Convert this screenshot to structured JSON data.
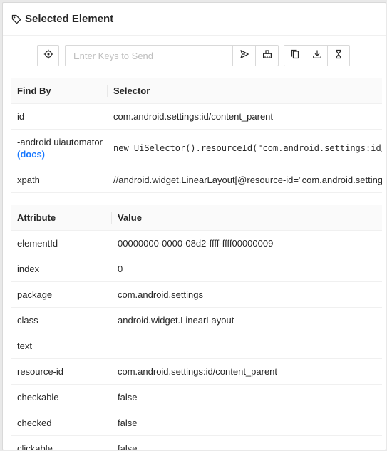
{
  "header": {
    "title": "Selected Element",
    "icon": "tag-icon"
  },
  "toolbar": {
    "input_placeholder": "Enter Keys to Send",
    "input_value": "",
    "buttons": [
      "locate-icon",
      "send-icon",
      "clear-icon",
      "copy-icon",
      "download-icon",
      "hourglass-icon"
    ]
  },
  "find_by": {
    "headers": {
      "col1": "Find By",
      "col2": "Selector"
    },
    "rows": [
      {
        "by": "id",
        "selector": "com.android.settings:id/content_parent"
      },
      {
        "by": "-android uiautomator",
        "docs": "(docs)",
        "selector": "new UiSelector().resourceId(\"com.android.settings:id/content_parent\")"
      },
      {
        "by": "xpath",
        "selector": "//android.widget.LinearLayout[@resource-id=\"com.android.settings:id/content_parent\"]"
      }
    ]
  },
  "attributes": {
    "headers": {
      "col1": "Attribute",
      "col2": "Value"
    },
    "rows": [
      {
        "name": "elementId",
        "value": "00000000-0000-08d2-ffff-ffff00000009"
      },
      {
        "name": "index",
        "value": "0"
      },
      {
        "name": "package",
        "value": "com.android.settings"
      },
      {
        "name": "class",
        "value": "android.widget.LinearLayout"
      },
      {
        "name": "text",
        "value": ""
      },
      {
        "name": "resource-id",
        "value": "com.android.settings:id/content_parent"
      },
      {
        "name": "checkable",
        "value": "false"
      },
      {
        "name": "checked",
        "value": "false"
      },
      {
        "name": "clickable",
        "value": "false"
      }
    ]
  },
  "colors": {
    "link": "#1677ff",
    "border": "#d9d9d9",
    "header_bg": "#fafafa"
  }
}
